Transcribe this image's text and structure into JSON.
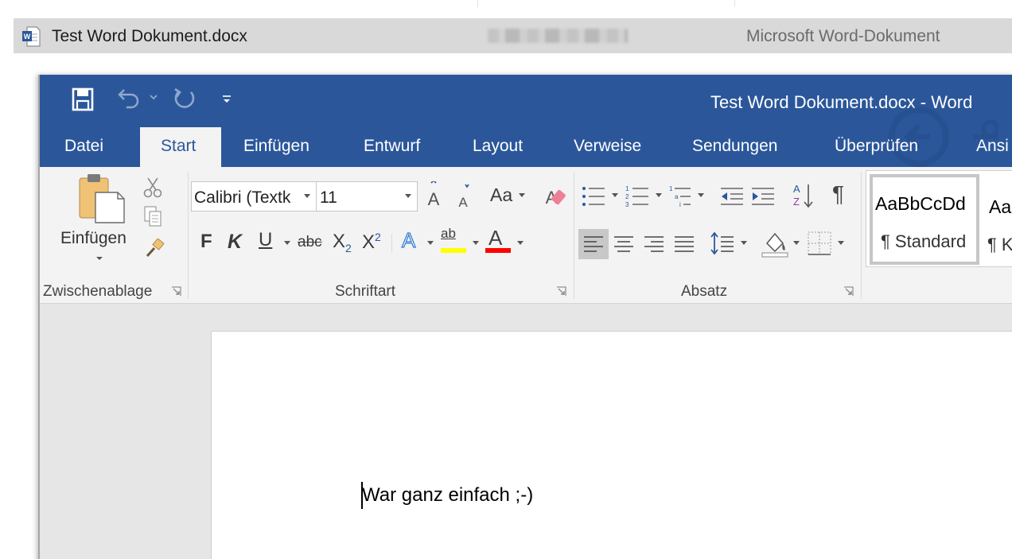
{
  "explorer": {
    "file_name": "Test Word Dokument.docx",
    "file_type": "Microsoft Word-Dokument"
  },
  "word": {
    "window_title": "Test Word Dokument.docx - Word",
    "tabs": [
      "Datei",
      "Start",
      "Einfügen",
      "Entwurf",
      "Layout",
      "Verweise",
      "Sendungen",
      "Überprüfen",
      "Ansi"
    ],
    "active_tab": "Start",
    "accent_color": "#2b579a",
    "clipboard": {
      "paste_label": "Einfügen",
      "group_label": "Zwischenablage"
    },
    "font": {
      "font_name": "Calibri (Textk",
      "font_size": "11",
      "change_case": "Aa",
      "bold": "F",
      "italic": "K",
      "underline": "U",
      "strikethrough": "abc",
      "subscript_base": "X",
      "subscript_mark": "2",
      "superscript_base": "X",
      "superscript_mark": "2",
      "text_effects": "A",
      "highlight": "ab",
      "font_color": "A",
      "highlight_color": "#ffff00",
      "font_color_value": "#ff0000",
      "group_label": "Schriftart"
    },
    "paragraph": {
      "group_label": "Absatz",
      "pilcrow": "¶"
    },
    "styles": {
      "normal_preview": "AaBbCcDd",
      "normal_label": "¶ Standard",
      "next_preview": "Aa",
      "next_label": "¶ K"
    },
    "document": {
      "text": "War ganz einfach ;-)"
    }
  }
}
